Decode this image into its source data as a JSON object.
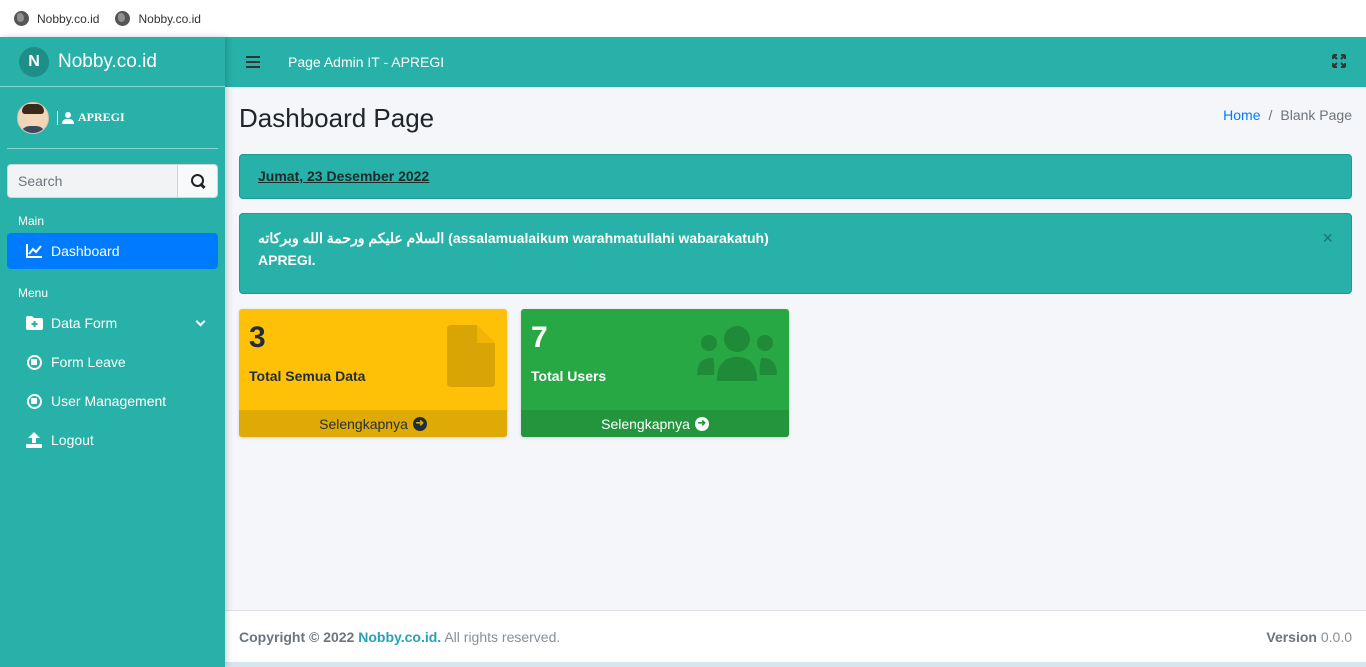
{
  "bookmarks": [
    {
      "label": "Nobby.co.id",
      "icon": "globe-icon"
    },
    {
      "label": "Nobby.co.id",
      "icon": "globe-icon"
    }
  ],
  "brand": {
    "logo_letter": "N",
    "name": "Nobby.co.id"
  },
  "user": {
    "name": "APREGI",
    "icon": "user-icon"
  },
  "search": {
    "placeholder": "Search",
    "value": ""
  },
  "sidebar": {
    "headers": {
      "main": "Main",
      "menu": "Menu"
    },
    "items": [
      {
        "label": "Dashboard",
        "icon": "chart-line-icon",
        "active": true
      },
      {
        "label": "Data Form",
        "icon": "folder-plus-icon",
        "has_submenu": true
      },
      {
        "label": "Form Leave",
        "icon": "circle-stop-icon"
      },
      {
        "label": "User Management",
        "icon": "circle-stop-icon"
      },
      {
        "label": "Logout",
        "icon": "upload-icon"
      }
    ]
  },
  "navbar": {
    "title": "Page Admin IT - APREGI"
  },
  "page": {
    "title": "Dashboard Page",
    "breadcrumb": {
      "home": "Home",
      "separator": "/",
      "current": "Blank Page"
    }
  },
  "alerts": {
    "date": "Jumat, 23 Desember 2022",
    "greeting_line1": "السلام عليكم ورحمة الله وبركاته (assalamualaikum warahmatullahi wabarakatuh)",
    "greeting_line2": "APREGI.",
    "close": "×"
  },
  "boxes": [
    {
      "value": "3",
      "label": "Total Semua Data",
      "link": "Selengkapnya",
      "color": "#ffc107",
      "icon": "file-icon"
    },
    {
      "value": "7",
      "label": "Total Users",
      "link": "Selengkapnya",
      "color": "#28a745",
      "icon": "users-icon"
    }
  ],
  "footer": {
    "copyright": "Copyright © 2022",
    "brand": "Nobby.co.id.",
    "rights": "All rights reserved.",
    "version_label": "Version",
    "version_value": "0.0.0"
  },
  "colors": {
    "primary": "#27b1a8",
    "active": "#007bff",
    "warning": "#ffc107",
    "success": "#28a745"
  }
}
